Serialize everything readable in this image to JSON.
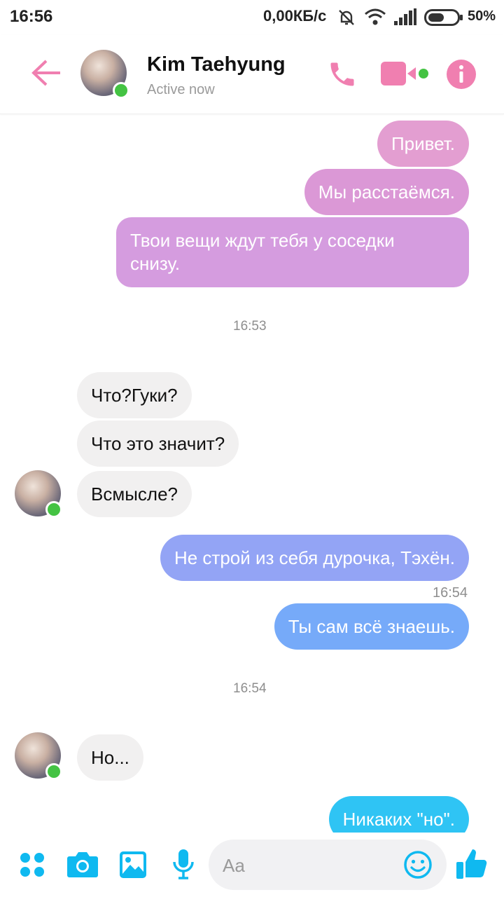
{
  "status_bar": {
    "time": "16:56",
    "network_speed": "0,00КБ/с",
    "battery": "50%"
  },
  "header": {
    "contact_name": "Kim Taehyung",
    "presence": "Active now"
  },
  "messages": {
    "m1": "Привет.",
    "m2": "Мы расстаёмся.",
    "m3_line1": "Твои вещи ждут тебя у соседки",
    "m3_line2": "снизу.",
    "ts1": "16:53",
    "r1": "Что?Гуки?",
    "r2": "Что это значит?",
    "r3": "Всмысле?",
    "m4": "Не строй из себя дурочка, Тэхён.",
    "ts2": "16:54",
    "m5": "Ты сам всё знаешь.",
    "ts3": "16:54",
    "r4": "Но...",
    "m6": "Никаких \"но\"."
  },
  "composer": {
    "placeholder": "Aa"
  },
  "colors": {
    "accent_pink": "#f07fb0",
    "online_green": "#44c343",
    "icon_blue": "#0fb9f0"
  },
  "icons": [
    "back-arrow-icon",
    "phone-icon",
    "video-icon",
    "info-icon",
    "apps-icon",
    "camera-icon",
    "image-icon",
    "microphone-icon",
    "emoji-icon",
    "thumbs-up-icon"
  ]
}
